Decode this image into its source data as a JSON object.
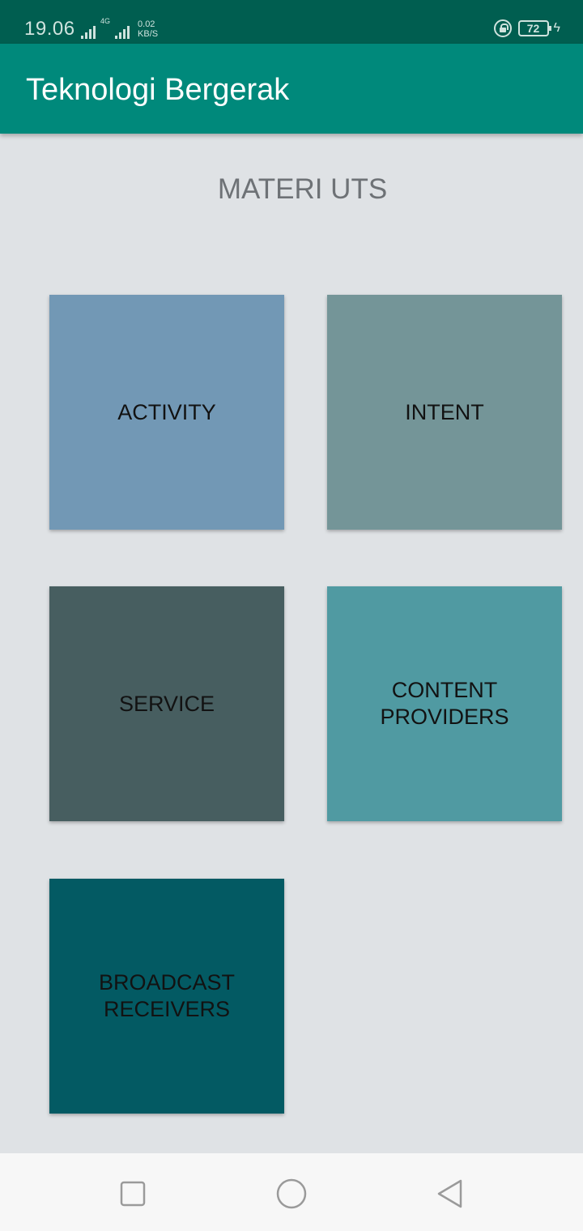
{
  "status_bar": {
    "time": "19.06",
    "network_type": "4G",
    "speed_value": "0.02",
    "speed_unit": "KB/S",
    "battery_level": "72",
    "icons": [
      "signal-icon",
      "signal-4g-icon",
      "screen-lock-rotation-icon",
      "battery-icon",
      "charging-icon"
    ]
  },
  "app_bar": {
    "title": "Teknologi Bergerak",
    "color": "#00897b"
  },
  "main": {
    "heading": "MATERI UTS",
    "tiles": [
      {
        "label": "ACTIVITY",
        "color": "#7298b5"
      },
      {
        "label": "INTENT",
        "color": "#749598"
      },
      {
        "label": "SERVICE",
        "color": "#475e60"
      },
      {
        "label": "CONTENT PROVIDERS",
        "color": "#509aa2"
      },
      {
        "label": "BROADCAST RECEIVERS",
        "color": "#035a63"
      }
    ]
  },
  "nav_bar": {
    "buttons": [
      "recent-apps-icon",
      "home-icon",
      "back-icon"
    ]
  }
}
